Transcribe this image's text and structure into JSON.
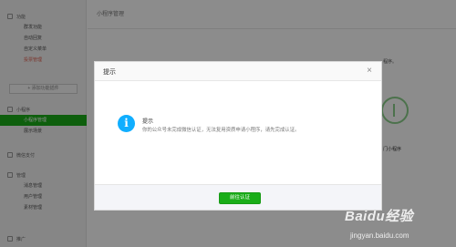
{
  "sidebar": {
    "groups": [
      {
        "title": "功能",
        "items": [
          "群发功能",
          "自动回复",
          "自定义菜单",
          "投票管理"
        ]
      },
      {
        "add_label": "+ 添加功能插件"
      },
      {
        "title": "小程序",
        "items": [
          "小程序管理",
          "展示场景"
        ]
      },
      {
        "title": "微信支付"
      },
      {
        "title": "管理",
        "items": [
          "消息管理",
          "用户管理",
          "素材管理"
        ]
      },
      {
        "title": "推广"
      }
    ]
  },
  "main": {
    "header": "小程序管理",
    "notice_fragment": "程序。",
    "card_title": "门小程序"
  },
  "dialog": {
    "title": "提示",
    "close_glyph": "×",
    "icon_glyph": "i",
    "message_title": "提示",
    "message_text": "你的公众号未完成微信认证，无法复用资质申请小程序，请先完成认证。",
    "button_label": "前往认证"
  },
  "watermark": {
    "logo": "Baidu经验",
    "url": "jingyan.baidu.com"
  },
  "colors": {
    "accent": "#1aad19",
    "info_icon": "#10aeff",
    "overlay": "rgba(0,0,0,0.45)"
  }
}
